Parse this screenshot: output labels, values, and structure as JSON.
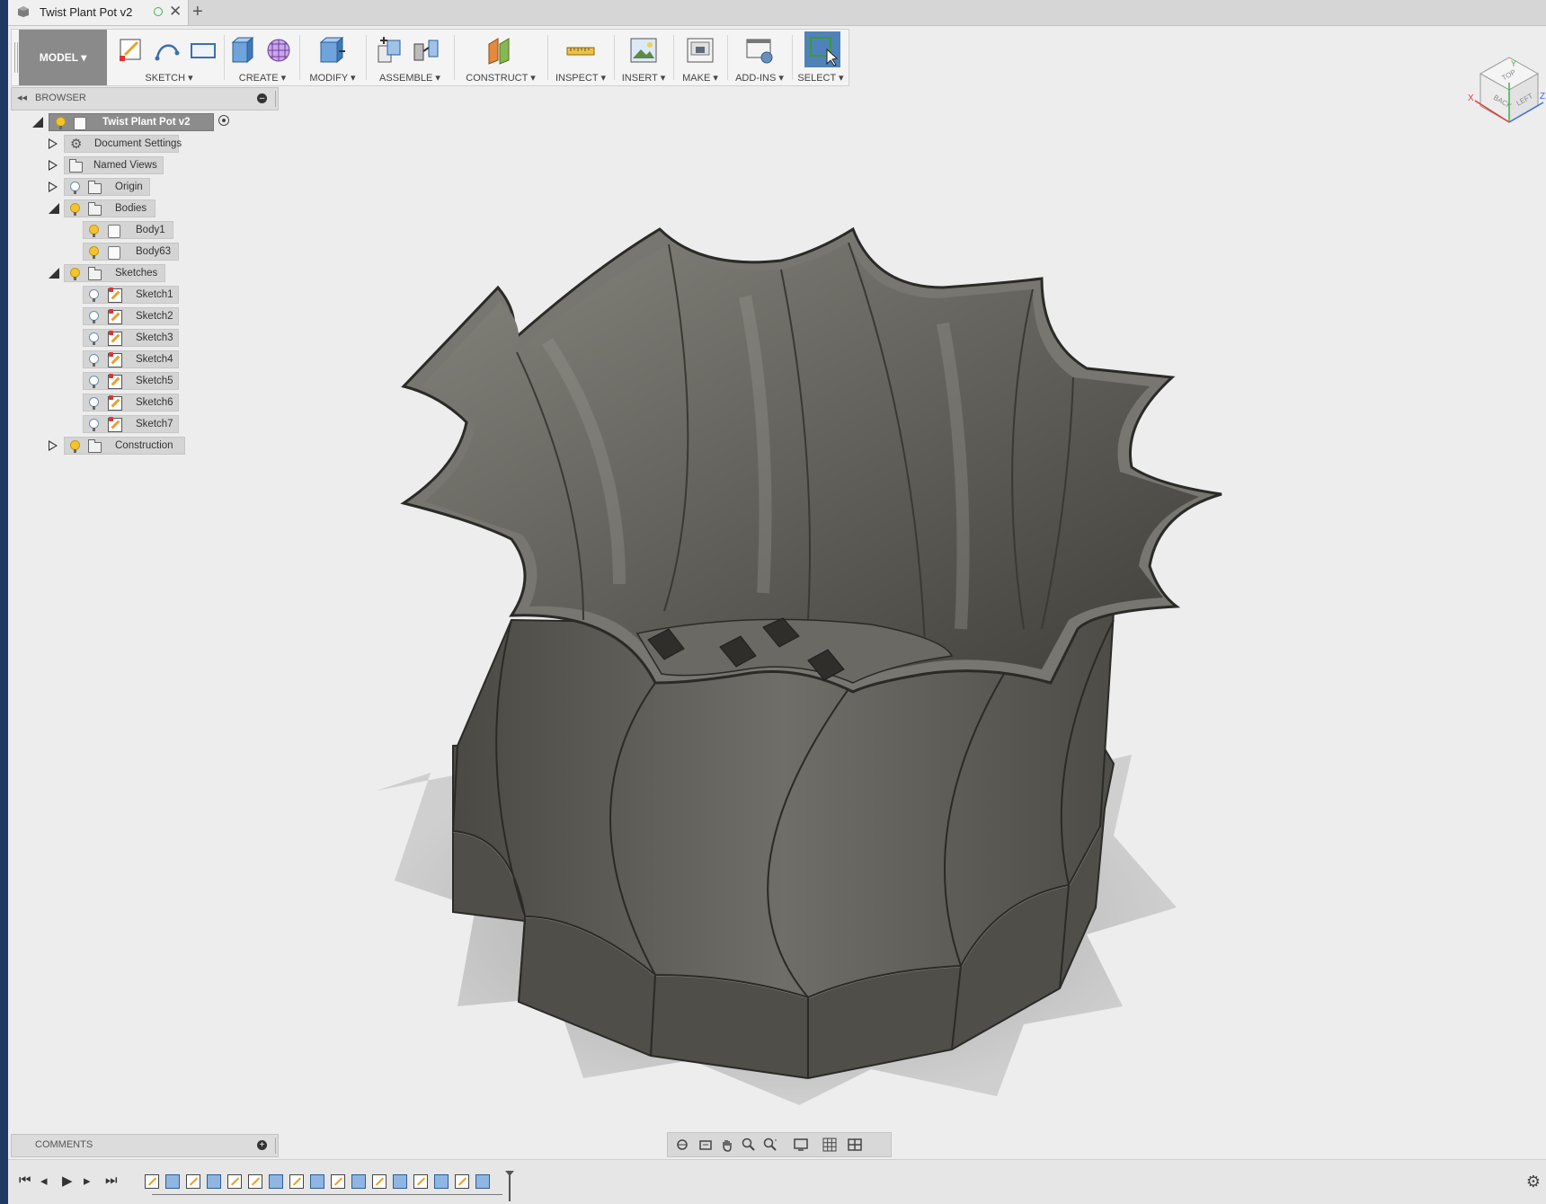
{
  "document_tab": {
    "title": "Twist Plant Pot v2",
    "close_glyph": "✕",
    "new_tab_glyph": "+"
  },
  "toolbar": {
    "workspace": "MODEL ▾",
    "groups": {
      "sketch": "SKETCH ▾",
      "create": "CREATE ▾",
      "modify": "MODIFY ▾",
      "assemble": "ASSEMBLE ▾",
      "construct": "CONSTRUCT ▾",
      "inspect": "INSPECT ▾",
      "insert": "INSERT ▾",
      "make": "MAKE ▾",
      "addins": "ADD-INS ▾",
      "select": "SELECT ▾"
    }
  },
  "browser": {
    "title": "BROWSER",
    "collapse_glyph": "◂◂",
    "root": "Twist Plant Pot v2",
    "items": {
      "document_settings": "Document Settings",
      "named_views": "Named Views",
      "origin": "Origin",
      "bodies": "Bodies",
      "body1": "Body1",
      "body63": "Body63",
      "sketches": "Sketches",
      "sketch1": "Sketch1",
      "sketch2": "Sketch2",
      "sketch3": "Sketch3",
      "sketch4": "Sketch4",
      "sketch5": "Sketch5",
      "sketch6": "Sketch6",
      "sketch7": "Sketch7",
      "construction": "Construction"
    }
  },
  "comments": {
    "title": "COMMENTS"
  },
  "viewcube": {
    "back": "BACK",
    "left": "LEFT",
    "top": "TOP",
    "axes": {
      "x": "X",
      "y": "Y",
      "z": "Z"
    }
  },
  "icons": [
    "doc-icon",
    "sketch-icon",
    "line-icon",
    "rectangle-icon",
    "extrude-icon",
    "form-icon",
    "press-pull-icon",
    "new-component-icon",
    "joint-icon",
    "plane-icon",
    "measure-icon",
    "insert-image-icon",
    "make-3dprint-icon",
    "scripts-icon",
    "select-icon",
    "gear-icon"
  ],
  "colors": {
    "select_active": "#4f82b8",
    "bulb_on": "#f2c432",
    "workspace_bg": "#8a8a8a",
    "model_body": "#5c5b55"
  }
}
